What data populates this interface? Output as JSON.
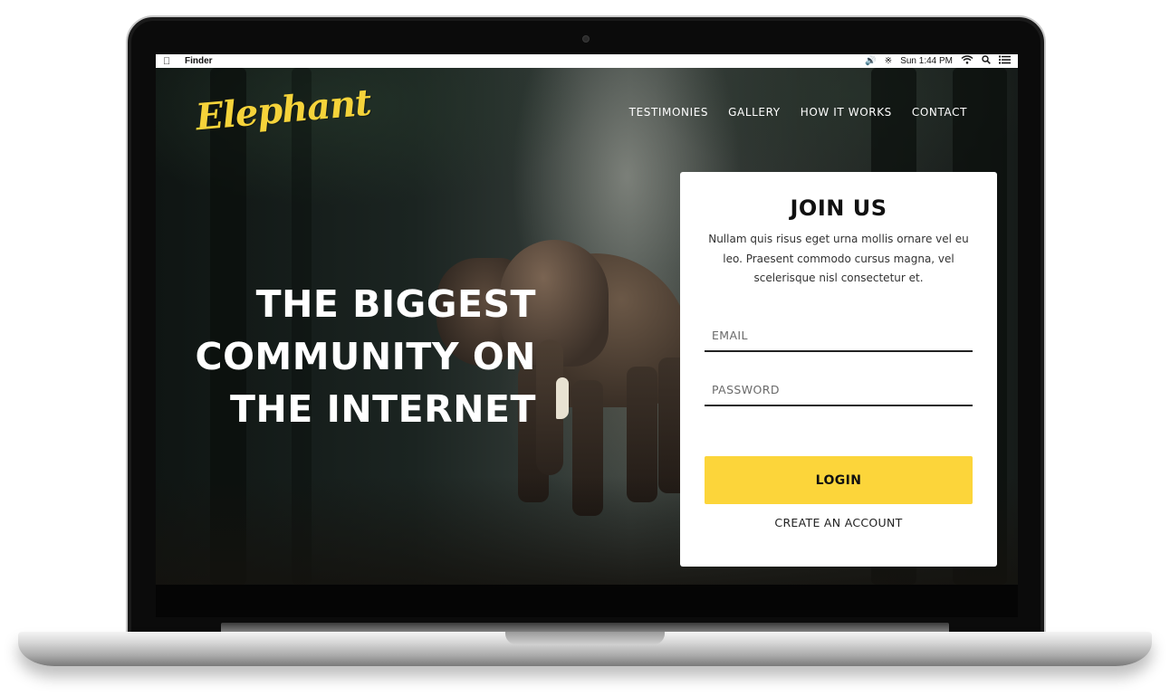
{
  "menubar": {
    "app_name": "Finder",
    "clock": "Sun 1:44 PM"
  },
  "site": {
    "logo_text": "Elephant",
    "nav": [
      {
        "label": "TESTIMONIES"
      },
      {
        "label": "GALLERY"
      },
      {
        "label": "HOW IT WORKS"
      },
      {
        "label": "CONTACT"
      }
    ],
    "headline": [
      "THE BIGGEST",
      "COMMUNITY ON",
      "THE INTERNET"
    ]
  },
  "join": {
    "title": "JOIN US",
    "description": "Nullam quis risus eget urna mollis ornare vel eu leo. Praesent commodo cursus magna, vel scelerisque nisl consectetur et.",
    "email_placeholder": "EMAIL",
    "password_placeholder": "PASSWORD",
    "login_label": "LOGIN",
    "create_account_label": "CREATE AN ACCOUNT"
  },
  "colors": {
    "accent": "#fcd53a",
    "logo": "#f5d33a"
  },
  "icons": [
    "apple-icon",
    "volume-icon",
    "bluetooth-icon",
    "wifi-icon",
    "spotlight-search-icon",
    "notification-center-icon"
  ]
}
